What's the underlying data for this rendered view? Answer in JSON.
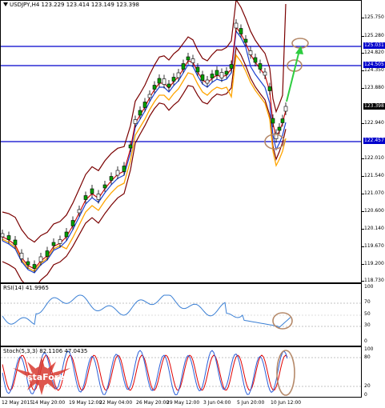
{
  "header": {
    "symbol": "USDJPY,H4",
    "ohlc": "123.229 123.414 123.149 123.398"
  },
  "price_axis": {
    "ticks": [
      "125.750",
      "125.280",
      "124.820",
      "124.350",
      "123.880",
      "122.940",
      "122.010",
      "121.540",
      "121.070",
      "120.600",
      "120.140",
      "119.670",
      "119.200",
      "118.730"
    ],
    "boxes": [
      {
        "label": "125.031",
        "color": "#0000cc",
        "text_color": "#ffffff"
      },
      {
        "label": "124.505",
        "color": "#0000cc",
        "text_color": "#ffffff"
      },
      {
        "label": "123.398",
        "color": "#000000",
        "text_color": "#ffffff"
      },
      {
        "label": "122.457",
        "color": "#0000cc",
        "text_color": "#ffffff"
      }
    ]
  },
  "rsi": {
    "label": "RSI(14) 41.9965",
    "ticks": [
      "100",
      "70",
      "50",
      "30",
      "0"
    ]
  },
  "stoch": {
    "label": "Stoch(5,3,3) 82.1106 47.0435",
    "ticks": [
      "100",
      "80",
      "20",
      "0"
    ]
  },
  "time_axis": {
    "labels": [
      "12 May 2015",
      "14 May 20:00",
      "19 May 12:00",
      "22 May 04:00",
      "26 May 20:00",
      "29 May 12:00",
      "3 Jun 04:00",
      "5 Jun 20:00",
      "10 Jun 12:00"
    ]
  },
  "watermark": {
    "brand": "InstaForex"
  },
  "colors": {
    "support_resistance": "#0000cc",
    "bollinger": "#7a0000",
    "ema_fast": "#cc0000",
    "ema_mid": "#1a3fd0",
    "ema_slow": "#ffa500",
    "rsi_line": "#3a7fd4",
    "stoch_main": "#2b5fd9",
    "stoch_signal": "#e00000",
    "annotation": "#b58969",
    "arrow": "#2ecc40",
    "logo": "#d93a30"
  }
}
